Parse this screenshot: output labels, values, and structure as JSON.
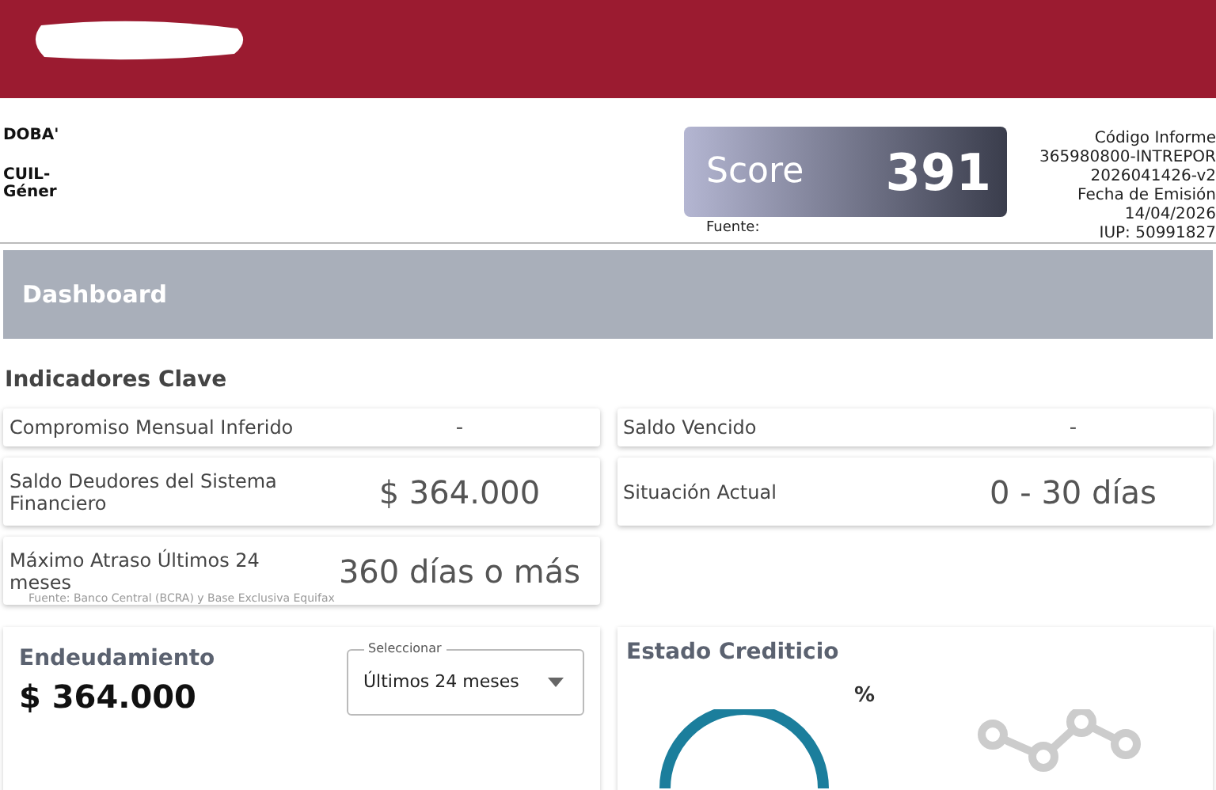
{
  "person": {
    "name": "DOBA'",
    "cuil": "CUIL-",
    "gender": "Géner"
  },
  "score": {
    "label": "Score",
    "value": "391",
    "source": "Fuente:"
  },
  "report": {
    "lines": [
      "Código Informe",
      "365980800-INTREPOR",
      "2026041426-v2",
      "Fecha de Emisión",
      "14/04/2026",
      "IUP: 50991827"
    ]
  },
  "dashboard": {
    "title": "Dashboard"
  },
  "indicators": {
    "title": "Indicadores Clave",
    "items": [
      {
        "label": "Compromiso Mensual Inferido",
        "value": "-",
        "kind": "compact"
      },
      {
        "label": "Saldo Vencido",
        "value": "-",
        "kind": "compact"
      },
      {
        "label": "Saldo Deudores del Sistema Financiero",
        "value": "$ 364.000",
        "kind": "tall"
      },
      {
        "label": "Situación Actual",
        "value": "0 - 30 días",
        "kind": "tall"
      },
      {
        "label": "Máximo Atraso Últimos 24 meses",
        "value": "360 días o más",
        "kind": "tall"
      }
    ],
    "source": "Fuente: Banco Central (BCRA) y Base Exclusiva Equifax"
  },
  "debt": {
    "title": "Endeudamiento",
    "amount": "$ 364.000",
    "select": {
      "label": "Seleccionar",
      "value": "Últimos 24 meses"
    }
  },
  "credit": {
    "title": "Estado Crediticio",
    "unit": "%"
  }
}
